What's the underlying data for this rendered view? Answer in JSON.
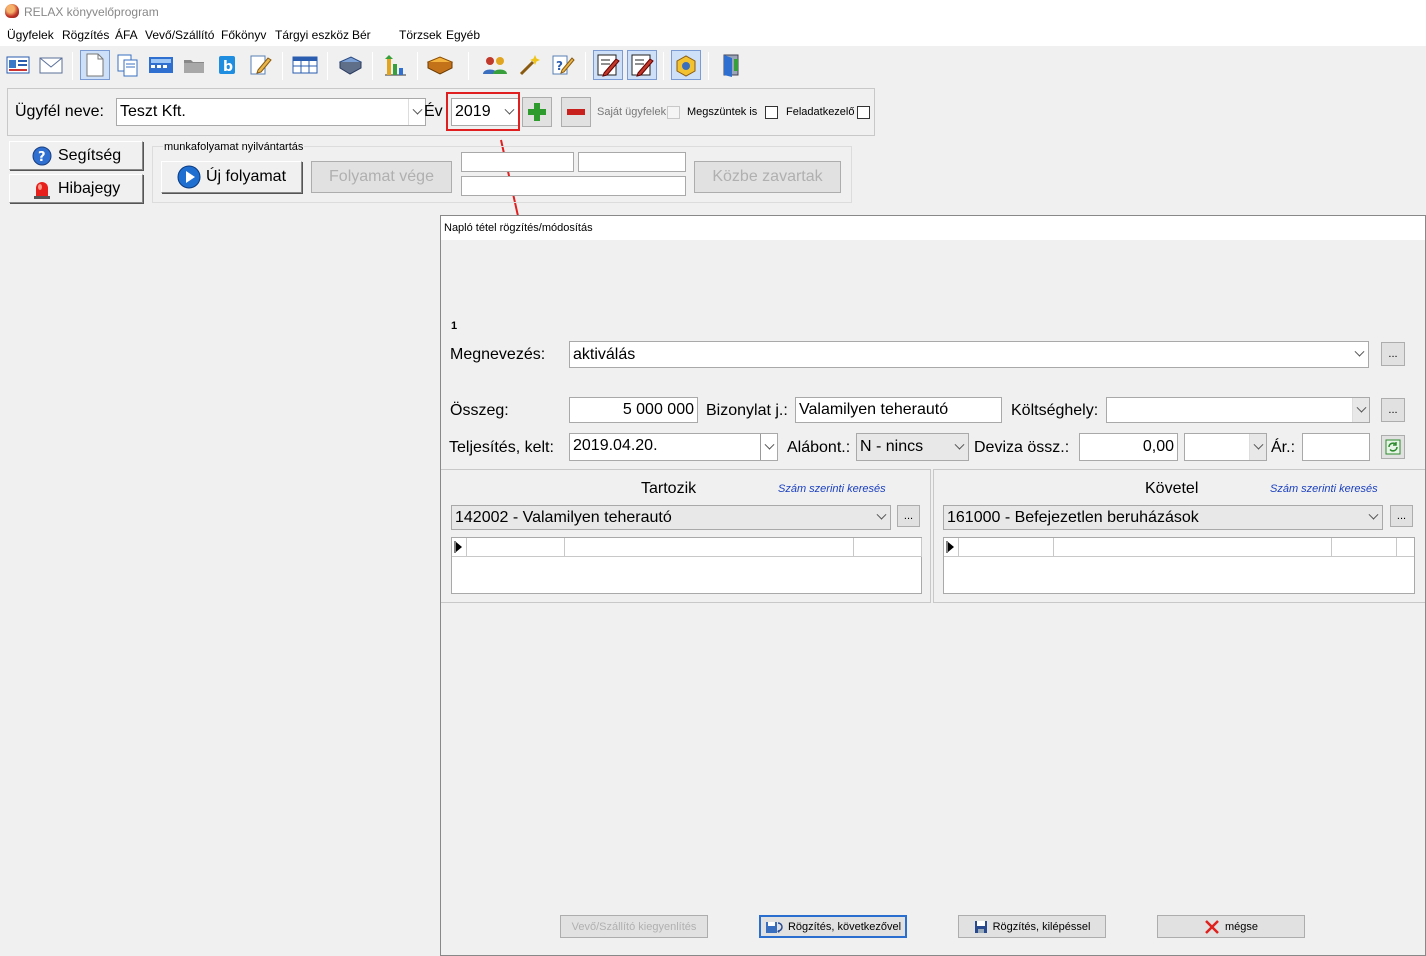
{
  "window": {
    "title": "RELAX könyvelőprogram"
  },
  "menu": [
    "Ügyfelek",
    "Rögzítés",
    "ÁFA",
    "Vevő/Szállító",
    "Főkönyv",
    "Tárgyi eszköz",
    "Bér",
    "Törzsek",
    "Egyéb"
  ],
  "client": {
    "name_label": "Ügyfél neve:",
    "name_value": "Teszt Kft.",
    "year_label": "Év",
    "year_value": "2019",
    "own_clients_label": "Saját ügyfelek",
    "terminated_label": "Megszüntek is",
    "task_manager_label": "Feladatkezelő"
  },
  "side_buttons": {
    "help": "Segítség",
    "bug": "Hibajegy"
  },
  "workflow": {
    "group_label": "munkafolyamat nyilvántartás",
    "new_label": "Új folyamat",
    "end_label": "Folyamat vége",
    "interrupted_label": "Közbe zavartak"
  },
  "dialog": {
    "title": "Napló tétel rögzítés/módosítás",
    "item_no": "1",
    "name_label": "Megnevezés:",
    "name_value": "aktiválás",
    "amount_label": "Összeg:",
    "amount_value": "5 000 000",
    "voucher_label": "Bizonylat j.:",
    "voucher_value": "Valamilyen teherautó",
    "cost_center_label": "Költséghely:",
    "cost_center_value": "",
    "date_label": "Teljesítés, kelt:",
    "date_value": "2019.04.20.",
    "subaccount_label": "Alábont.:",
    "subaccount_value": "N - nincs",
    "fx_amount_label": "Deviza össz.:",
    "fx_amount_value": "0,00",
    "currency_value": "",
    "rate_label": "Ár.:",
    "rate_value": "",
    "debit": {
      "title": "Tartozik",
      "search_link": "Szám szerinti keresés",
      "account_value": "142002 - Valamilyen teherautó"
    },
    "credit": {
      "title": "Követel",
      "search_link": "Szám szerinti keresés",
      "account_value": "161000 - Befejezetlen beruházások"
    },
    "ellipsis": "...",
    "buttons": {
      "reconcile": "Vevő/Szállító kiegyenlítés",
      "save_next": "Rögzítés, következővel",
      "save_exit": "Rögzítés, kilépéssel",
      "cancel": "mégse"
    }
  },
  "annotation": {
    "highlight_color": "#e02020"
  }
}
